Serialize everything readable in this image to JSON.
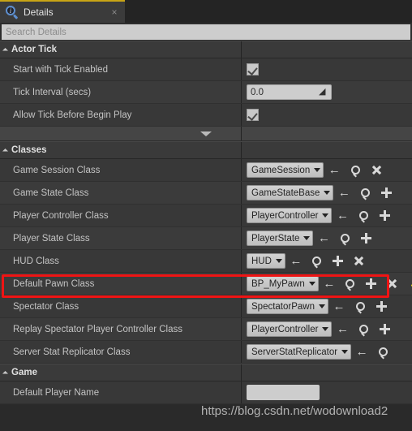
{
  "tab": {
    "title": "Details",
    "icon": "details-magnifier-icon",
    "close_label": "×"
  },
  "search": {
    "placeholder": "Search Details",
    "value": ""
  },
  "sections": [
    {
      "name": "actor-tick",
      "title": "Actor Tick",
      "rows": [
        {
          "label": "Start with Tick Enabled",
          "widget": "checkbox",
          "checked": true
        },
        {
          "label": "Tick Interval (secs)",
          "widget": "number",
          "value": "0.0"
        },
        {
          "label": "Allow Tick Before Begin Play",
          "widget": "checkbox",
          "checked": true
        }
      ]
    },
    {
      "name": "classes",
      "title": "Classes",
      "rows": [
        {
          "label": "Game Session Class",
          "widget": "combo",
          "value": "GameSession",
          "icons": [
            "back-arrow-icon",
            "browse-search-icon",
            "clear-x-icon"
          ]
        },
        {
          "label": "Game State Class",
          "widget": "combo",
          "value": "GameStateBase",
          "icons": [
            "back-arrow-icon",
            "browse-search-icon",
            "new-plus-icon"
          ]
        },
        {
          "label": "Player Controller Class",
          "widget": "combo",
          "value": "PlayerController",
          "icons": [
            "back-arrow-icon",
            "browse-search-icon",
            "new-plus-icon"
          ]
        },
        {
          "label": "Player State Class",
          "widget": "combo",
          "value": "PlayerState",
          "icons": [
            "back-arrow-icon",
            "browse-search-icon",
            "new-plus-icon"
          ]
        },
        {
          "label": "HUD Class",
          "widget": "combo",
          "value": "HUD",
          "icons": [
            "back-arrow-icon",
            "browse-search-icon",
            "new-plus-icon",
            "clear-x-icon"
          ]
        },
        {
          "label": "Default Pawn Class",
          "widget": "combo",
          "value": "BP_MyPawn",
          "icons": [
            "back-arrow-icon",
            "browse-search-icon",
            "new-plus-icon",
            "clear-x-icon"
          ],
          "reset_icon": "↲",
          "highlighted": true
        },
        {
          "label": "Spectator Class",
          "widget": "combo",
          "value": "SpectatorPawn",
          "icons": [
            "back-arrow-icon",
            "browse-search-icon",
            "new-plus-icon"
          ]
        },
        {
          "label": "Replay Spectator Player Controller Class",
          "widget": "combo",
          "value": "PlayerController",
          "icons": [
            "back-arrow-icon",
            "browse-search-icon",
            "new-plus-icon"
          ]
        },
        {
          "label": "Server Stat Replicator Class",
          "widget": "combo",
          "value": "ServerStatReplicator",
          "icons": [
            "back-arrow-icon",
            "browse-search-icon"
          ]
        }
      ]
    },
    {
      "name": "game",
      "title": "Game",
      "rows": [
        {
          "label": "Default Player Name",
          "widget": "text",
          "value": ""
        }
      ]
    }
  ],
  "watermark": "https://blog.csdn.net/wodownload2",
  "colors": {
    "tab_accent": "#c8a415",
    "highlight": "#ef1414",
    "reset_icon": "#e3d21a"
  }
}
